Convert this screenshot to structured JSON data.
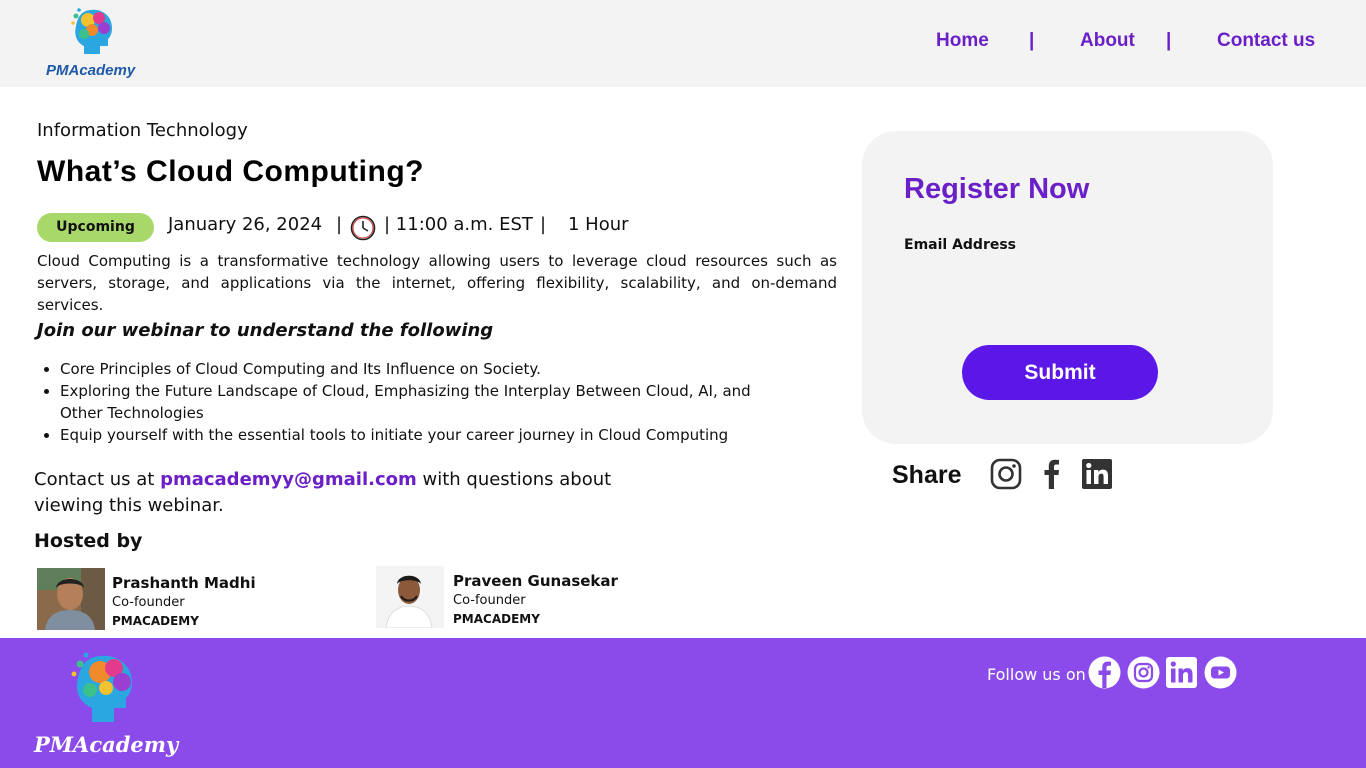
{
  "header": {
    "logo_text": "PMAcademy",
    "nav": [
      {
        "label": "Home"
      },
      {
        "label": "About"
      },
      {
        "label": "Contact us"
      }
    ],
    "separator": "|"
  },
  "event": {
    "category": "Information Technology",
    "title": "What’s Cloud Computing?",
    "badge": "Upcoming",
    "date": "January 26, 2024",
    "time": "| 11:00 a.m. EST",
    "separator": "|",
    "duration": "1 Hour",
    "description": "Cloud Computing is a transformative technology allowing users to leverage cloud resources such as servers, storage, and applications via the internet, offering flexibility, scalability, and on-demand services.",
    "join_heading": "Join our webinar to understand the following",
    "bullets": [
      "Core Principles of Cloud Computing and Its Influence on Society.",
      "Exploring the Future Landscape of Cloud, Emphasizing the Interplay Between Cloud, AI, and Other Technologies",
      "Equip yourself with the essential tools to initiate your career journey in Cloud Computing"
    ]
  },
  "contact": {
    "prefix": "Contact us at ",
    "email": "pmacademyy@gmail.com",
    "suffix": " with questions about viewing this webinar."
  },
  "hosts": {
    "heading": "Hosted by",
    "list": [
      {
        "name": "Prashanth Madhi",
        "role": "Co-founder",
        "org": "PMACADEMY"
      },
      {
        "name": "Praveen Gunasekar",
        "role": "Co-founder",
        "org": "PMACADEMY"
      }
    ]
  },
  "register": {
    "title": "Register Now",
    "email_label": "Email Address",
    "email_value": "",
    "email_placeholder": "",
    "submit_label": "Submit"
  },
  "share": {
    "label": "Share",
    "icons": [
      "instagram-icon",
      "facebook-icon",
      "linkedin-icon"
    ]
  },
  "footer": {
    "logo_text": "PMAcademy",
    "follow_label": "Follow us on",
    "icons": [
      "facebook-icon",
      "instagram-icon",
      "linkedin-icon",
      "youtube-icon"
    ]
  },
  "colors": {
    "accent": "#6a1fc7",
    "button": "#5b17e8",
    "footer": "#8a4bea",
    "badge": "#a8d86a",
    "header_bg": "#f3f3f3"
  }
}
